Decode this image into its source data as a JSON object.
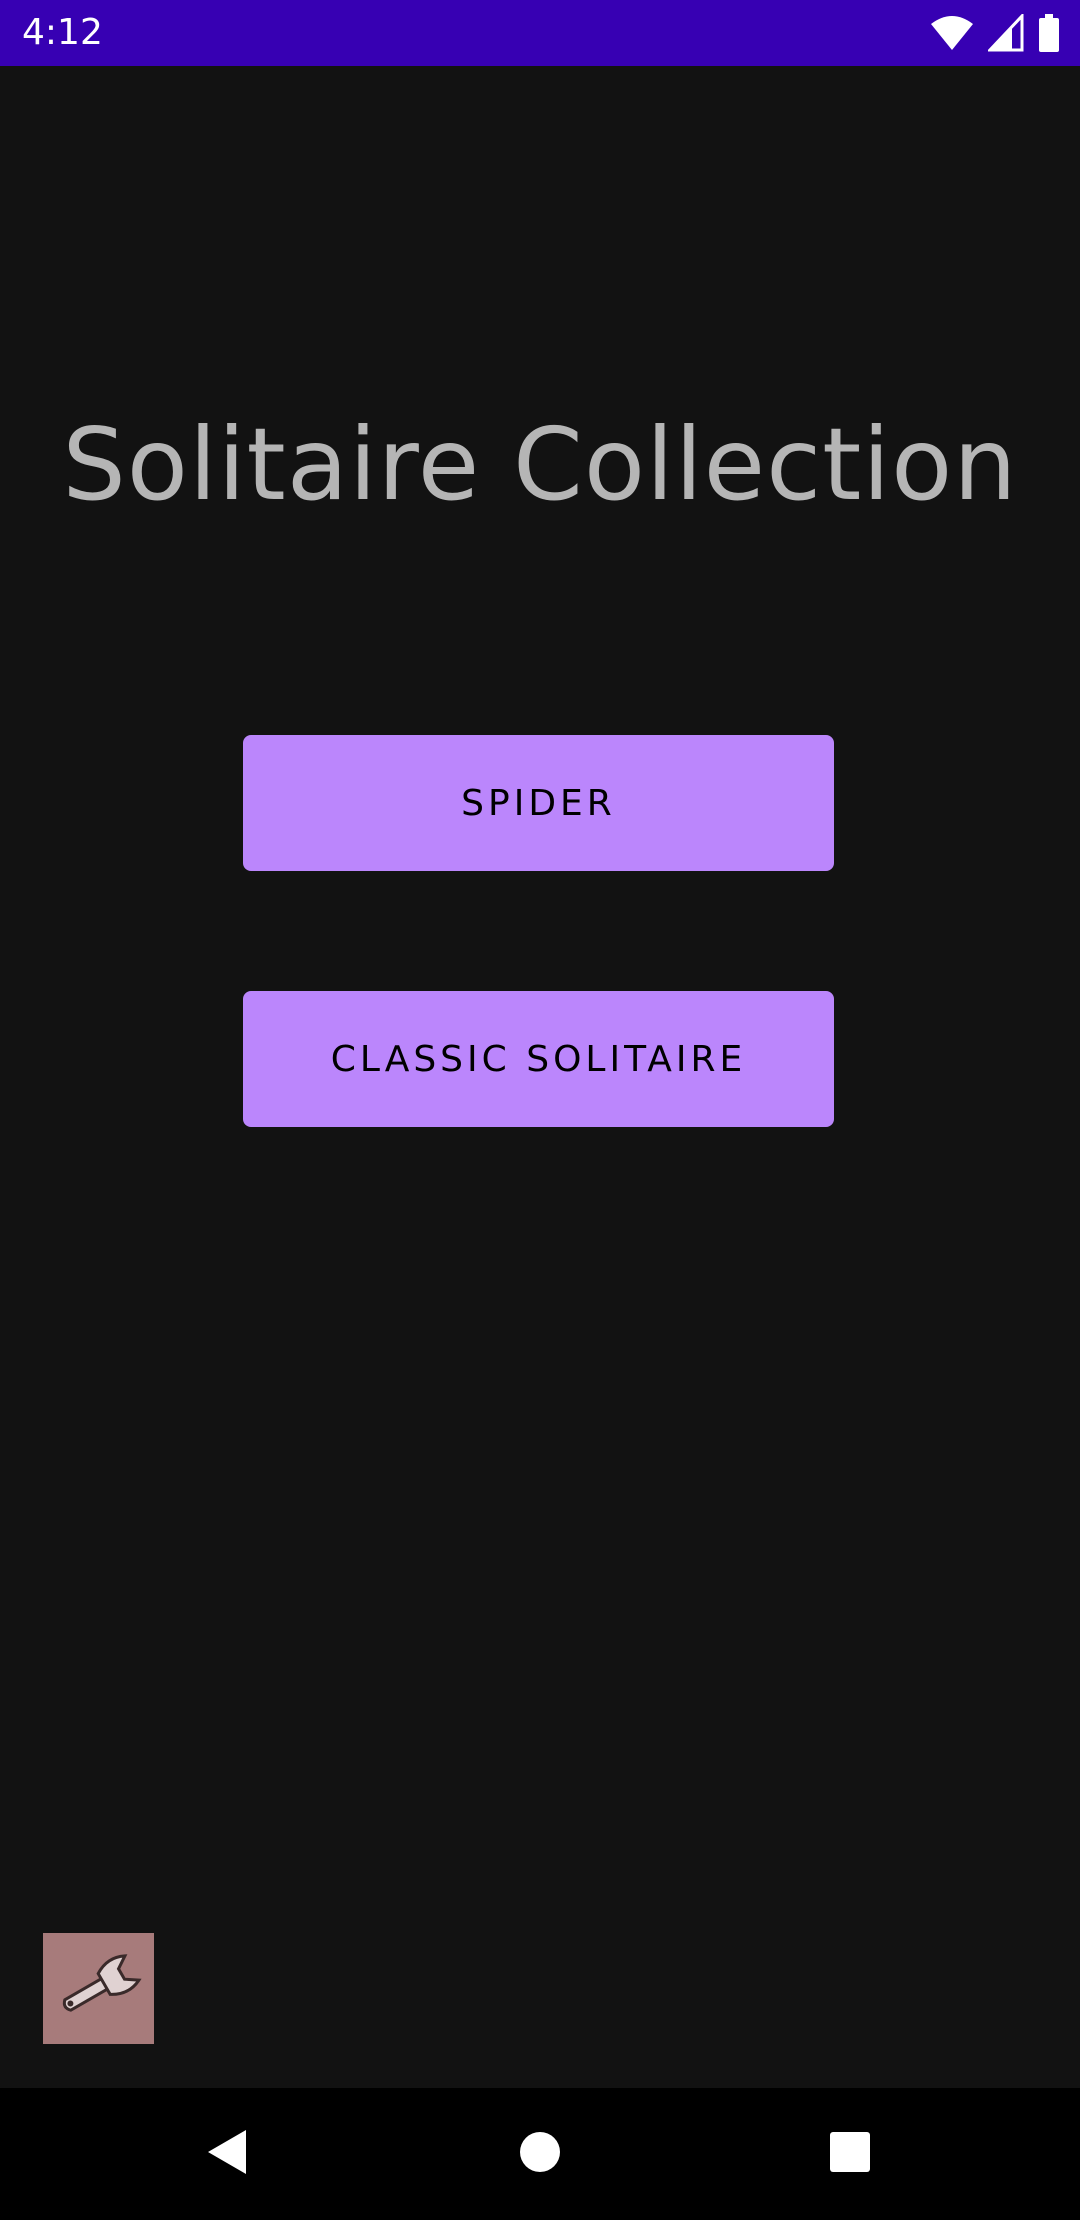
{
  "status_bar": {
    "time": "4:12",
    "background_color": "#3700b3",
    "icons": [
      "wifi-icon",
      "cellular-signal-icon",
      "battery-icon"
    ]
  },
  "main": {
    "title": "Solitaire Collection",
    "buttons": {
      "spider_label": "SPIDER",
      "classic_label": "CLASSIC SOLITAIRE"
    },
    "accent_color": "#bb86fc",
    "settings_icon": "wrench-icon"
  },
  "nav_bar": {
    "icons": [
      "back-icon",
      "home-icon",
      "recents-icon"
    ]
  }
}
